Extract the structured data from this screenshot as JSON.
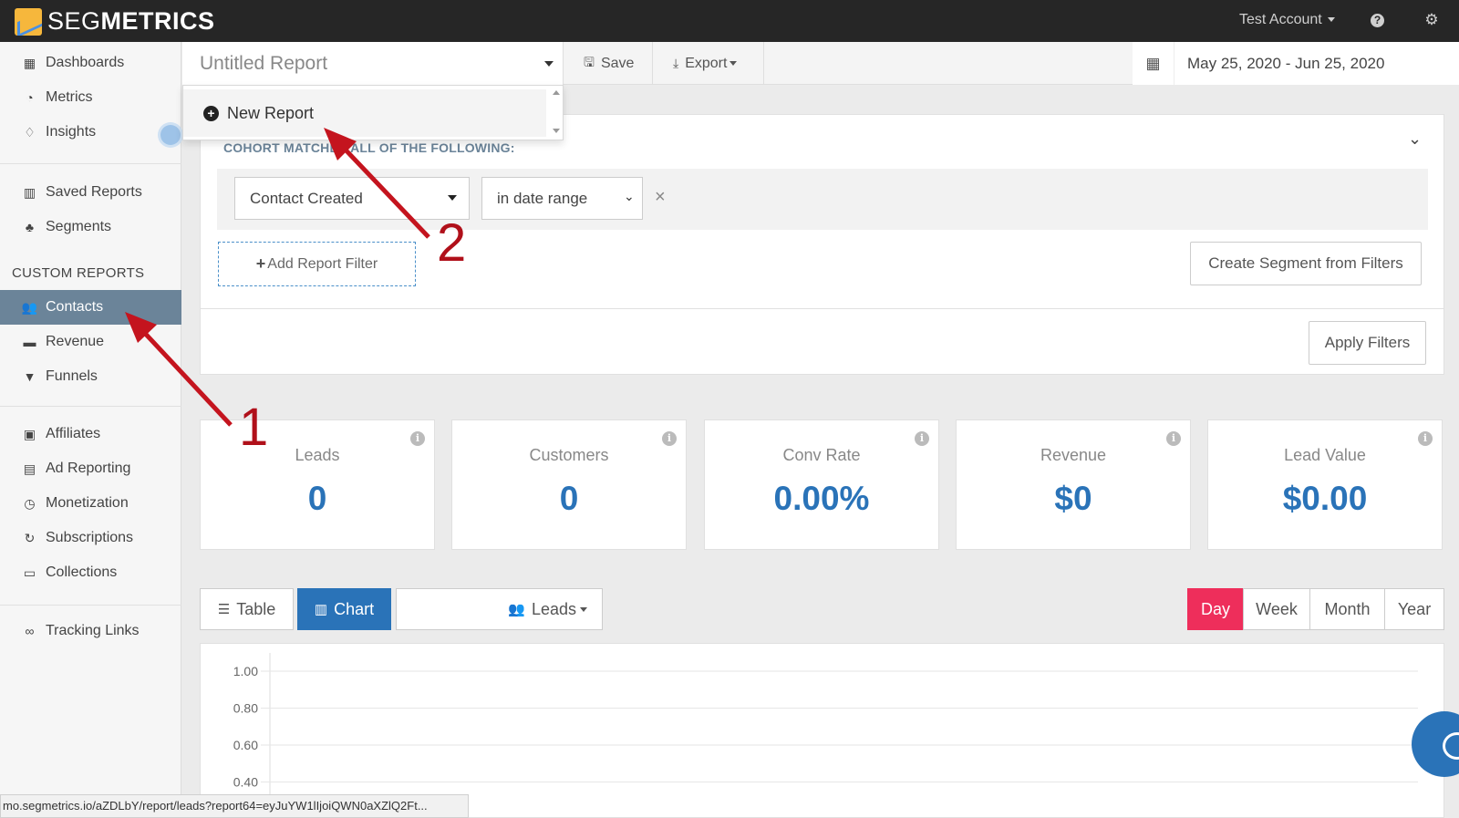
{
  "app": {
    "brand_light": "SEG",
    "brand_bold": "METRICS",
    "account_label": "Test Account",
    "help_icon": "question-circle-icon",
    "settings_icon": "gear-icon"
  },
  "sidebar": {
    "top_items": [
      {
        "label": "Dashboards",
        "icon": "th-large-icon"
      },
      {
        "label": "Metrics",
        "icon": "dashboard-icon"
      },
      {
        "label": "Insights",
        "icon": "lightbulb-icon"
      }
    ],
    "saved_items": [
      {
        "label": "Saved Reports",
        "icon": "bar-chart-icon"
      },
      {
        "label": "Segments",
        "icon": "sitemap-icon"
      }
    ],
    "custom_section_title": "CUSTOM REPORTS",
    "custom_items": [
      {
        "label": "Contacts",
        "icon": "users-icon",
        "active": true
      },
      {
        "label": "Revenue",
        "icon": "money-icon"
      },
      {
        "label": "Funnels",
        "icon": "filter-icon"
      }
    ],
    "more_items": [
      {
        "label": "Affiliates",
        "icon": "id-card-icon"
      },
      {
        "label": "Ad Reporting",
        "icon": "ad-grid-icon"
      },
      {
        "label": "Monetization",
        "icon": "clock-icon"
      },
      {
        "label": "Subscriptions",
        "icon": "refresh-icon"
      },
      {
        "label": "Collections",
        "icon": "money-bill-icon"
      }
    ],
    "bottom_items": [
      {
        "label": "Tracking Links",
        "icon": "link-icon"
      }
    ]
  },
  "toolbar": {
    "report_title": "Untitled Report",
    "save_label": "Save",
    "export_label": "Export",
    "date_range": "May 25, 2020 - Jun 25, 2020"
  },
  "dropdown": {
    "new_report_label": "New Report"
  },
  "filters": {
    "cohort_label": "COHORT MATCHES ALL OF THE FOLLOWING:",
    "field_value": "Contact Created",
    "operator_value": "in date range",
    "add_filter_label": "Add Report Filter",
    "create_segment_label": "Create Segment from Filters",
    "apply_label": "Apply Filters"
  },
  "stats": [
    {
      "label": "Leads",
      "value": "0"
    },
    {
      "label": "Customers",
      "value": "0"
    },
    {
      "label": "Conv Rate",
      "value": "0.00%"
    },
    {
      "label": "Revenue",
      "value": "$0"
    },
    {
      "label": "Lead Value",
      "value": "$0.00"
    }
  ],
  "chart_controls": {
    "table_label": "Table",
    "chart_label": "Chart",
    "metric_label": "Leads",
    "periods": [
      "Day",
      "Week",
      "Month",
      "Year"
    ],
    "active_period": "Day"
  },
  "chart": {
    "y_ticks": [
      "1.00",
      "0.80",
      "0.60",
      "0.40"
    ]
  },
  "status_bar": {
    "url": "mo.segmetrics.io/aZDLbY/report/leads?report64=eyJuYW1lIjoiQWN0aXZlQ2Ft..."
  },
  "annotations": {
    "arrow1_number": "1",
    "arrow2_number": "2"
  },
  "colors": {
    "accent_blue": "#2a73b8",
    "active_nav": "#6b8499",
    "period_active": "#ee2e5b",
    "annotation_red": "#b0101a"
  }
}
